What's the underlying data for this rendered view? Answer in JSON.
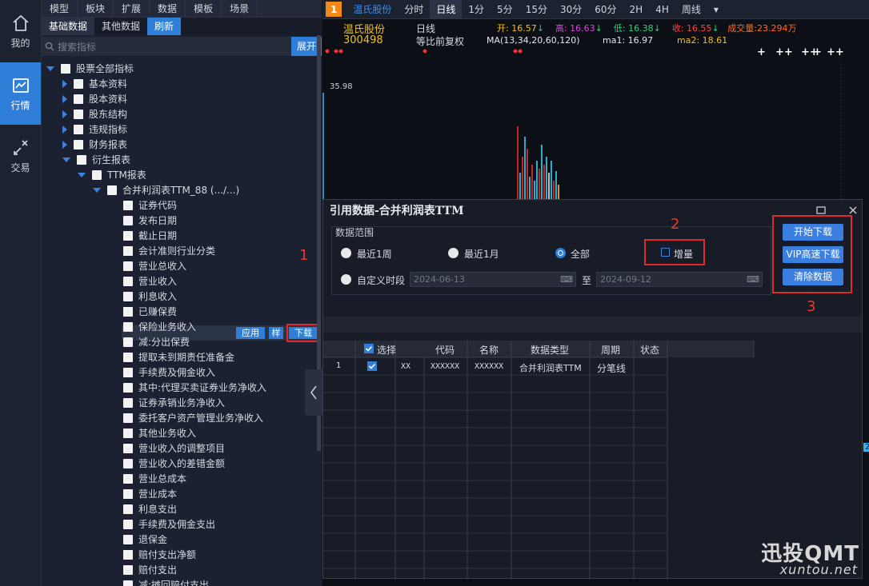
{
  "leftnav": [
    {
      "label": "我的",
      "icon": "home-icon"
    },
    {
      "label": "行情",
      "icon": "chart-icon",
      "active": true
    },
    {
      "label": "交易",
      "icon": "trade-icon"
    }
  ],
  "tree_panel": {
    "top_tabs": [
      "模型",
      "板块",
      "扩展",
      "数据",
      "模板",
      "场景"
    ],
    "sub_tabs": [
      "基础数据",
      "其他数据"
    ],
    "refresh": "刷新",
    "search_placeholder": "搜索指标",
    "expand": "展开",
    "root": "股票全部指标",
    "categories": [
      "基本资料",
      "股本资料",
      "股东结构",
      "违规指标",
      "财务报表",
      "衍生报表"
    ],
    "ttm": "TTM报表",
    "report": "合并利润表TTM_88 (.../...)",
    "fields": [
      "证券代码",
      "发布日期",
      "截止日期",
      "会计准则行业分类",
      "营业总收入",
      "营业收入",
      "利息收入",
      "已赚保费",
      "保险业务收入",
      "减:分出保费",
      "提取未到期责任准备金",
      "手续费及佣金收入",
      "其中:代理买卖证券业务净收入",
      "证券承销业务净收入",
      "委托客户资产管理业务净收入",
      "其他业务收入",
      "营业收入的调整项目",
      "营业收入的差错金额",
      "营业总成本",
      "营业成本",
      "利息支出",
      "手续费及佣金支出",
      "退保金",
      "赔付支出净额",
      "赔付支出",
      "减:摊回赔付支出"
    ],
    "row_actions": [
      "应用",
      "样",
      "下载"
    ]
  },
  "chart": {
    "tab_badge": "1",
    "stock_name": "温氏股份",
    "periods": [
      "分时",
      "日线",
      "1分",
      "5分",
      "15分",
      "30分",
      "60分",
      "2H",
      "4H",
      "周线"
    ],
    "active_period": "日线",
    "code": "300498",
    "name_line": "温氏股份",
    "period_label": "日线",
    "adjust_label": "等比前复权",
    "open_label": "开:",
    "open": "16.57",
    "high_label": "高:",
    "high": "16.63",
    "low_label": "低:",
    "low": "16.38",
    "close_label": "收:",
    "close": "16.55",
    "vol_label": "成交量:",
    "vol": "23.294万",
    "ma_text": "MA(13,34,20,60,120)",
    "ma1": "ma1: 16.97",
    "ma2": "ma2: 18.61",
    "price_top": "35.98",
    "right_label": "2"
  },
  "dialog": {
    "title": "引用数据-合并利润表TTM",
    "range_label": "数据范围",
    "options": [
      "最近1周",
      "最近1月",
      "全部"
    ],
    "selected": "全部",
    "incremental": "增量",
    "custom": "自定义时段",
    "date_from": "2024-06-13",
    "to": "至",
    "date_to": "2024-09-12",
    "buttons": [
      "开始下载",
      "VIP高速下载",
      "清除数据"
    ],
    "columns": [
      "选择",
      "代码",
      "名称",
      "数据类型",
      "周期",
      "状态"
    ],
    "rows": [
      {
        "idx": "1",
        "col1": "XX",
        "code": "XXXXXX",
        "name": "XXXXXX",
        "type": "合并利润表TTM",
        "period": "分笔线",
        "status": ""
      }
    ]
  },
  "annotations": [
    "1",
    "2",
    "3"
  ],
  "watermark": {
    "brand": "迅投QMT",
    "url": "xuntou.net"
  },
  "colors": {
    "accent": "#2f7fd8",
    "annotation": "#e0282a",
    "up": "#ff4040",
    "down": "#2fd07a"
  }
}
